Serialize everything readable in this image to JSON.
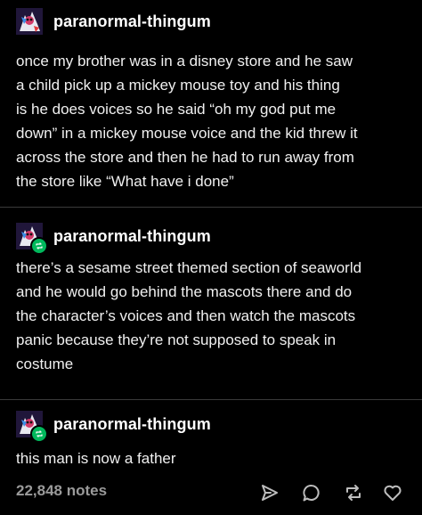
{
  "posts": [
    {
      "username": "paranormal-thingum",
      "reblogged": false,
      "text": "once my brother was in a disney store and he saw\na child pick up a  mickey mouse toy and  his thing\nis he does voices  so he said “oh my god put me\ndown”  in a mickey mouse voice and the kid  threw it\nacross the store and  then he had to run away from\nthe store like   “What have i done”"
    },
    {
      "username": "paranormal-thingum",
      "reblogged": true,
      "text": "there’s a sesame street themed section of  seaworld\nand he would go behind the mascots there  and do\nthe character’s voices and then watch the mascots\npanic because they’re not supposed to speak in\ncostume"
    },
    {
      "username": "paranormal-thingum",
      "reblogged": true,
      "text": "this man is now a father"
    }
  ],
  "footer": {
    "notes": "22,848 notes",
    "actions": [
      "share-icon",
      "reply-icon",
      "reblog-icon",
      "like-icon"
    ]
  },
  "colors": {
    "background": "#000000",
    "text": "#f0f0f0",
    "muted": "#9a9a9a",
    "reblog_badge": "#00b85c"
  }
}
